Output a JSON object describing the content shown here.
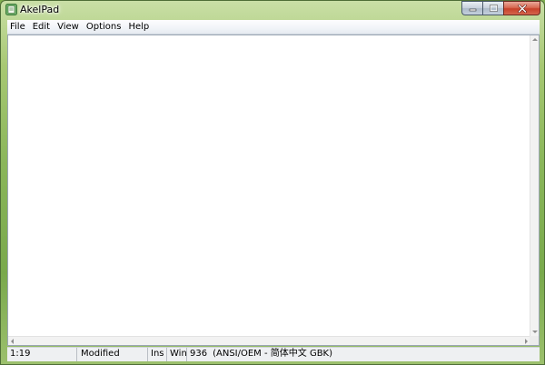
{
  "window": {
    "title": "AkelPad",
    "icon": "akelpad-app-icon",
    "caption_icons": [
      "minimize-icon",
      "maximize-icon",
      "close-icon"
    ]
  },
  "menu": [
    "File",
    "Edit",
    "View",
    "Options",
    "Help"
  ],
  "editor": {
    "content": ""
  },
  "statusbar": {
    "position": "1:19",
    "state": "Modified",
    "insert_mode": "Ins",
    "newline": "Win",
    "codepage": "936",
    "codepage_name": "(ANSI/OEM - 简体中文 GBK)"
  },
  "colors": {
    "close_button": "#c7412a",
    "frame_tint": "#8ab65a"
  }
}
